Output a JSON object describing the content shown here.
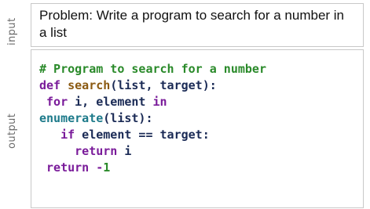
{
  "labels": {
    "input": "input",
    "output": "output"
  },
  "problem": {
    "text": "Problem: Write a program to search for a number in a list"
  },
  "code": {
    "line1": {
      "comment": "# Program to search for a number"
    },
    "line2": {
      "kw_def": "def",
      "funcname": "search",
      "rest": "(list, target):"
    },
    "line3": {
      "indent": " ",
      "kw_for": "for",
      "vars": " i, element ",
      "kw_in": "in"
    },
    "line4": {
      "builtin": "enumerate",
      "rest": "(list):"
    },
    "line5": {
      "indent": "   ",
      "kw_if": "if",
      "expr": " element == target:"
    },
    "line6": {
      "indent": "     ",
      "kw_return": "return",
      "value": " i"
    },
    "line7": {
      "indent": " ",
      "kw_return": "return",
      "operator": " -",
      "number": "1"
    }
  },
  "colors": {
    "comment": "#2a8a2a",
    "keyword": "#7a1b9a",
    "funcname": "#8b5a12",
    "builtin": "#1d7a8a",
    "plain": "#1a2a55",
    "number": "#2a8a2a",
    "side_label": "#6b6b6b",
    "border": "#c8c8c8"
  }
}
